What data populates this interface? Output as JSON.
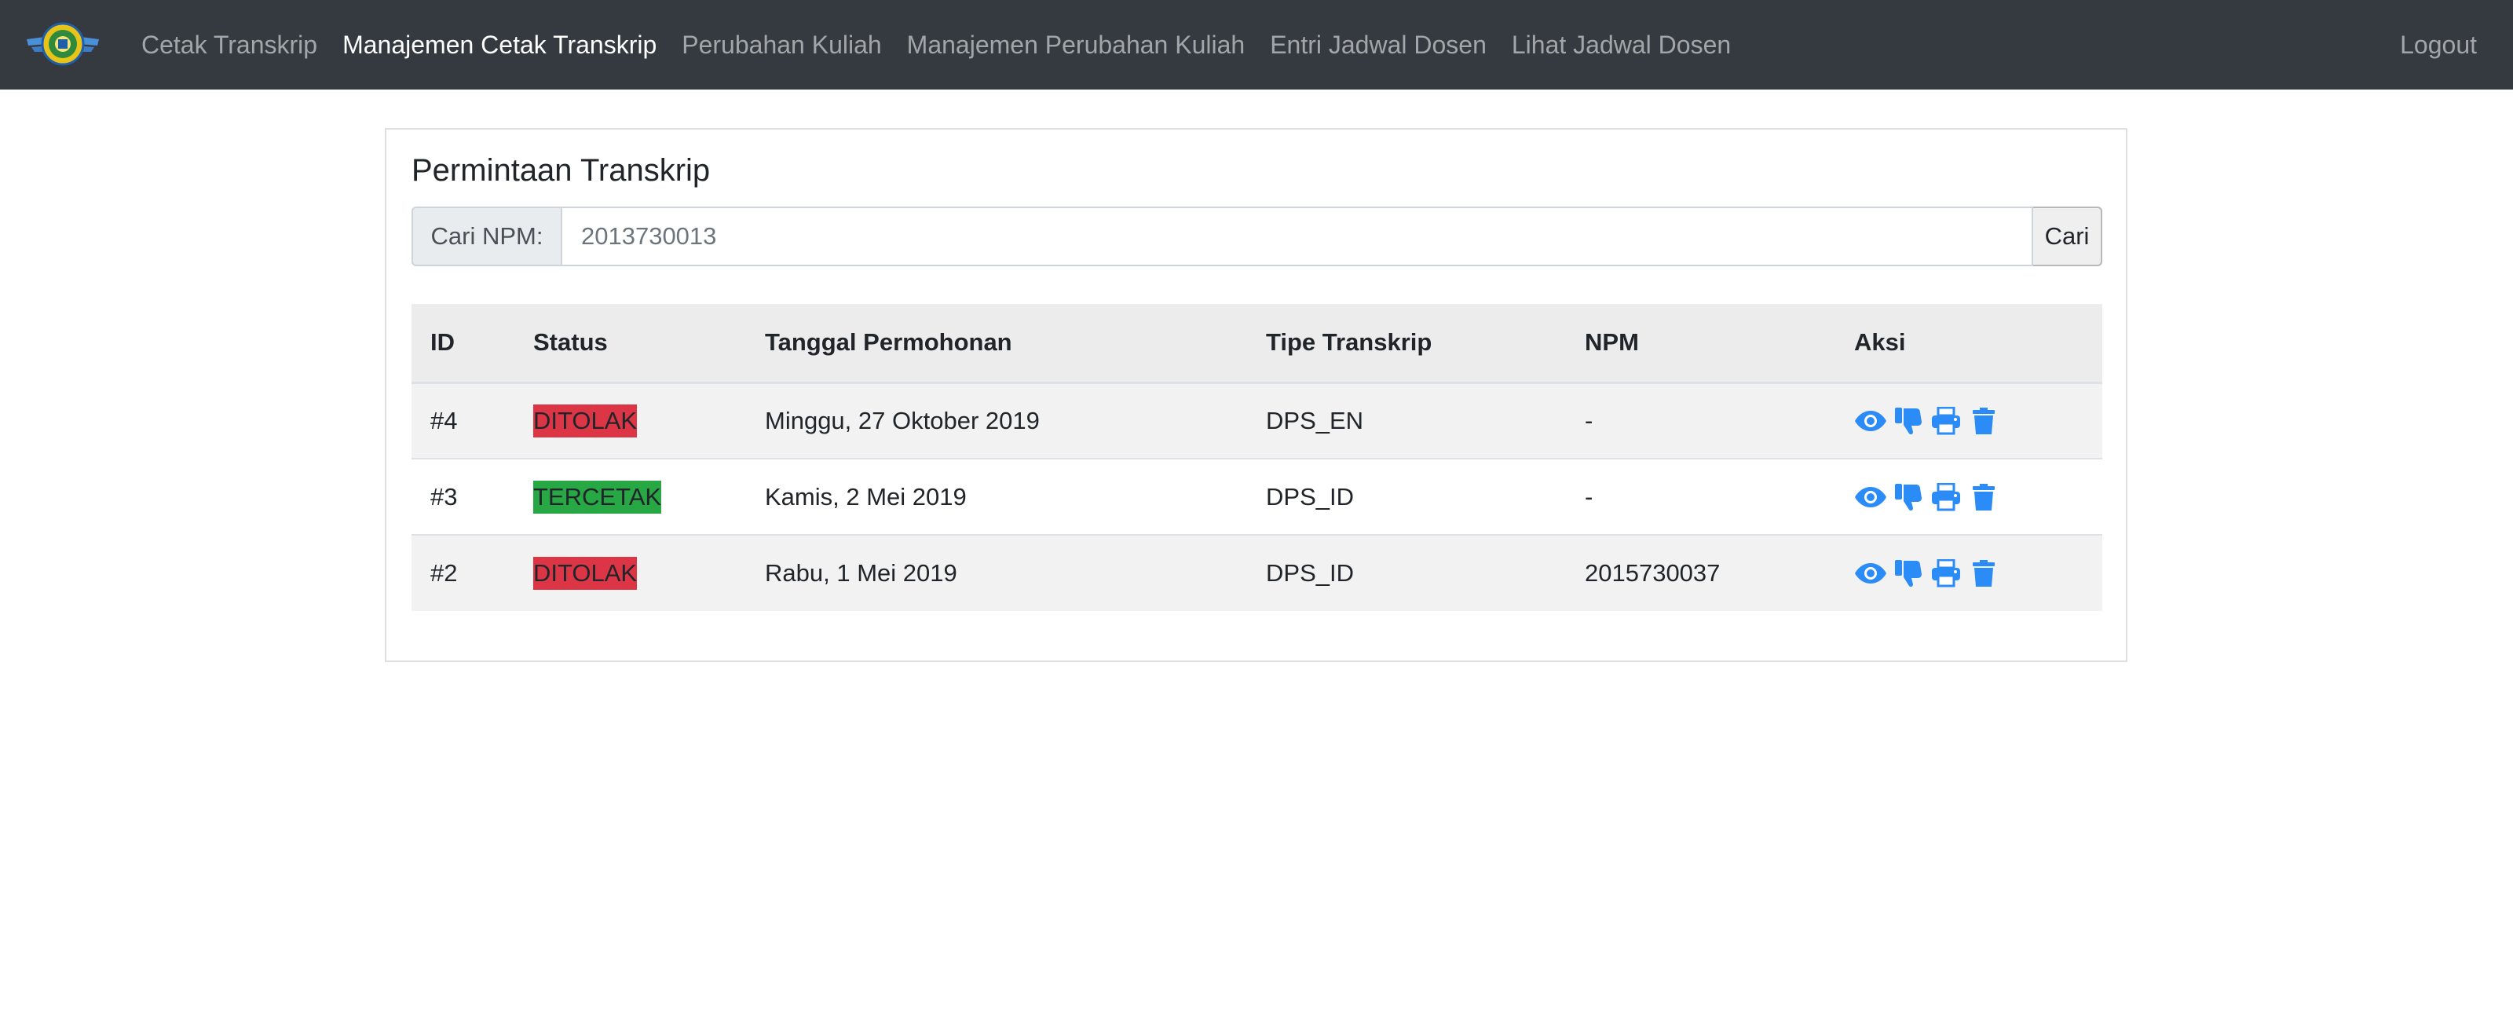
{
  "nav": {
    "brand_icon": "university-logo-icon",
    "links": [
      {
        "label": "Cetak Transkrip",
        "active": false
      },
      {
        "label": "Manajemen Cetak Transkrip",
        "active": true
      },
      {
        "label": "Perubahan Kuliah",
        "active": false
      },
      {
        "label": "Manajemen Perubahan Kuliah",
        "active": false
      },
      {
        "label": "Entri Jadwal Dosen",
        "active": false
      },
      {
        "label": "Lihat Jadwal Dosen",
        "active": false
      }
    ],
    "logout_label": "Logout"
  },
  "card": {
    "title": "Permintaan Transkrip",
    "search": {
      "label": "Cari NPM:",
      "placeholder": "2013730013",
      "button_label": "Cari"
    }
  },
  "table": {
    "headers": [
      "ID",
      "Status",
      "Tanggal Permohonan",
      "Tipe Transkrip",
      "NPM",
      "Aksi"
    ],
    "rows": [
      {
        "id": "#4",
        "status": "DITOLAK",
        "status_color": "#dc3545",
        "date": "Minggu, 27 Oktober 2019",
        "type": "DPS_EN",
        "npm": "-"
      },
      {
        "id": "#3",
        "status": "TERCETAK",
        "status_color": "#28a745",
        "date": "Kamis, 2 Mei 2019",
        "type": "DPS_ID",
        "npm": "-"
      },
      {
        "id": "#2",
        "status": "DITOLAK",
        "status_color": "#dc3545",
        "date": "Rabu, 1 Mei 2019",
        "type": "DPS_ID",
        "npm": "2015730037"
      }
    ],
    "action_icons": [
      "eye-icon",
      "thumbs-down-icon",
      "print-icon",
      "trash-icon"
    ]
  },
  "colors": {
    "navbar": "#343a40",
    "action_blue": "#2b8cf7",
    "danger": "#dc3545",
    "success": "#28a745"
  }
}
